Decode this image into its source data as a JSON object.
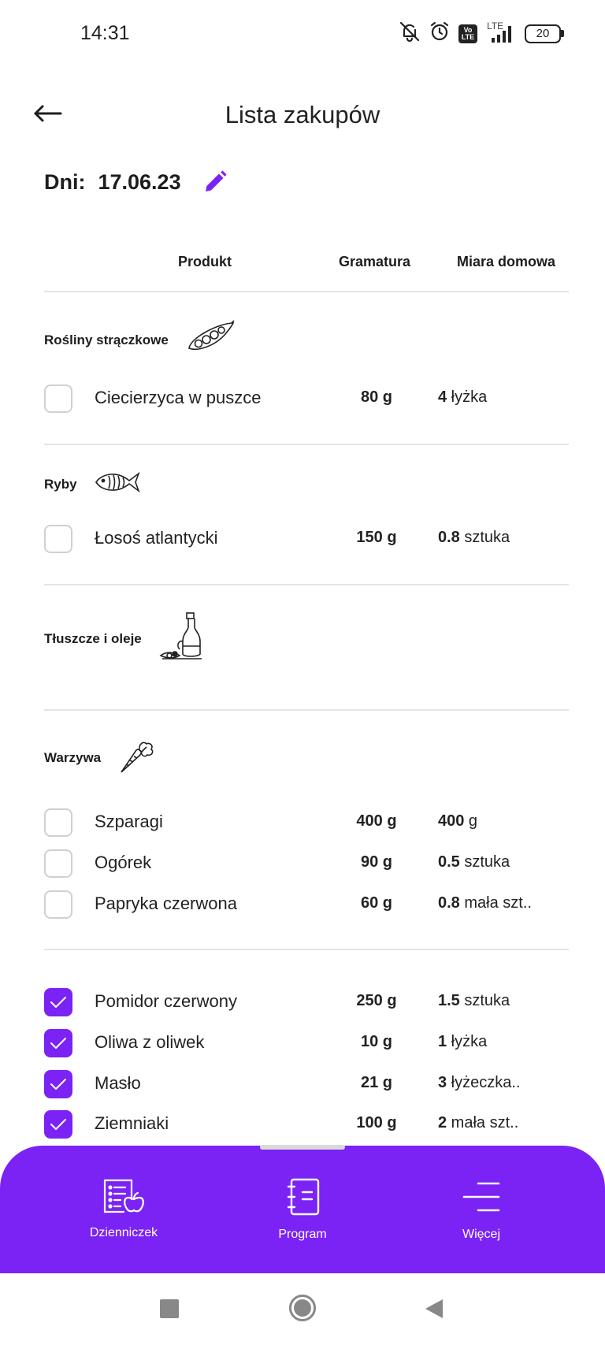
{
  "status_bar": {
    "time": "14:31",
    "battery": "20",
    "network": "LTE",
    "volte_top": "Vo",
    "volte_bottom": "LTE"
  },
  "header": {
    "title": "Lista zakupów"
  },
  "date": {
    "label": "Dni:",
    "value": "17.06.23"
  },
  "columns": {
    "product": "Produkt",
    "weight": "Gramatura",
    "measure": "Miara domowa"
  },
  "categories": [
    {
      "label": "Rośliny strączkowe",
      "icon": "pea-pod-icon"
    },
    {
      "label": "Ryby",
      "icon": "fish-icon"
    },
    {
      "label": "Tłuszcze i oleje",
      "icon": "oil-bottle-icon"
    },
    {
      "label": "Warzywa",
      "icon": "carrot-icon"
    }
  ],
  "items": [
    {
      "name": "Ciecierzyca w puszce",
      "weight": "80 g",
      "qty": "4",
      "unit": " łyżka",
      "checked": false
    },
    {
      "name": "Łosoś atlantycki",
      "weight": "150 g",
      "qty": "0.8",
      "unit": " sztuka",
      "checked": false
    },
    {
      "name": "Szparagi",
      "weight": "400 g",
      "qty": "400",
      "unit": " g",
      "checked": false
    },
    {
      "name": "Ogórek",
      "weight": "90 g",
      "qty": "0.5",
      "unit": " sztuka",
      "checked": false
    },
    {
      "name": "Papryka czerwona",
      "weight": "60 g",
      "qty": "0.8",
      "unit": " mała szt..",
      "checked": false
    },
    {
      "name": "Pomidor czerwony",
      "weight": "250 g",
      "qty": "1.5",
      "unit": " sztuka",
      "checked": true
    },
    {
      "name": "Oliwa z oliwek",
      "weight": "10 g",
      "qty": "1",
      "unit": " łyżka",
      "checked": true
    },
    {
      "name": "Masło",
      "weight": "21 g",
      "qty": "3",
      "unit": " łyżeczka..",
      "checked": true
    },
    {
      "name": "Ziemniaki",
      "weight": "100 g",
      "qty": "2",
      "unit": " mała szt..",
      "checked": true
    }
  ],
  "bottom_nav": [
    {
      "label": "Dzienniczek",
      "icon": "diary-apple-icon"
    },
    {
      "label": "Program",
      "icon": "notebook-icon"
    },
    {
      "label": "Więcej",
      "icon": "menu-lines-icon"
    }
  ],
  "colors": {
    "accent": "#7b22f5",
    "divider": "#e4e4e4",
    "text": "#1d1d1f"
  }
}
